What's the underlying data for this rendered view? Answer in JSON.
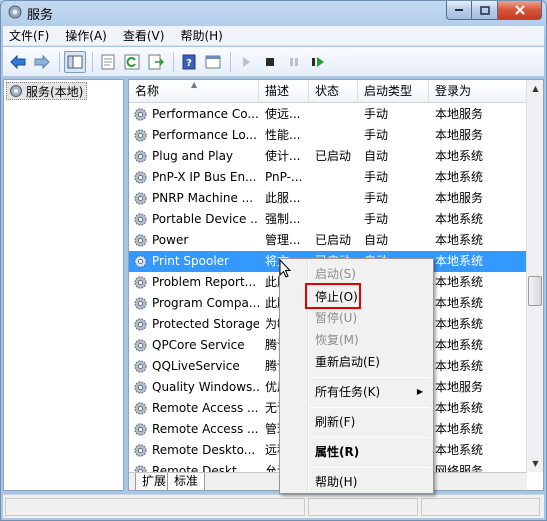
{
  "window": {
    "title": "服务"
  },
  "menubar": [
    "文件(F)",
    "操作(A)",
    "查看(V)",
    "帮助(H)"
  ],
  "toolbar": {
    "icons": [
      "back-arrow-icon",
      "forward-arrow-icon",
      "show-tree-icon",
      "properties-icon",
      "refresh-icon",
      "export-icon",
      "help-icon",
      "console-icon",
      "start-icon",
      "stop-icon",
      "pause-icon",
      "restart-icon"
    ]
  },
  "tree": {
    "root_label": "服务(本地)"
  },
  "columns": [
    "名称",
    "描述",
    "状态",
    "启动类型",
    "登录为"
  ],
  "rows": [
    {
      "name": "Performance Co...",
      "desc": "使远...",
      "state": "",
      "type": "手动",
      "logon": "本地服务"
    },
    {
      "name": "Performance Lo...",
      "desc": "性能...",
      "state": "",
      "type": "手动",
      "logon": "本地服务"
    },
    {
      "name": "Plug and Play",
      "desc": "使计...",
      "state": "已启动",
      "type": "自动",
      "logon": "本地系统"
    },
    {
      "name": "PnP-X IP Bus En...",
      "desc": "PnP-...",
      "state": "",
      "type": "手动",
      "logon": "本地系统"
    },
    {
      "name": "PNRP Machine ...",
      "desc": "此服...",
      "state": "",
      "type": "手动",
      "logon": "本地服务"
    },
    {
      "name": "Portable Device ...",
      "desc": "强制...",
      "state": "",
      "type": "手动",
      "logon": "本地系统"
    },
    {
      "name": "Power",
      "desc": "管理...",
      "state": "已启动",
      "type": "自动",
      "logon": "本地系统"
    },
    {
      "name": "Print Spooler",
      "desc": "将文",
      "state": "已启动",
      "type": "自动",
      "logon": "本地系统",
      "selected": true
    },
    {
      "name": "Problem Report...",
      "desc": "此服",
      "state": "",
      "type": "",
      "logon": "本地系统"
    },
    {
      "name": "Program Compa...",
      "desc": "此服",
      "state": "",
      "type": "",
      "logon": "本地系统"
    },
    {
      "name": "Protected Storage",
      "desc": "为敏",
      "state": "",
      "type": "",
      "logon": "本地系统"
    },
    {
      "name": "QPCore Service",
      "desc": "腾讯",
      "state": "",
      "type": "",
      "logon": "本地系统"
    },
    {
      "name": "QQLiveService",
      "desc": "腾讯",
      "state": "",
      "type": "",
      "logon": "本地系统"
    },
    {
      "name": "Quality Windows...",
      "desc": "优质",
      "state": "",
      "type": "",
      "logon": "本地服务"
    },
    {
      "name": "Remote Access ...",
      "desc": "无论",
      "state": "",
      "type": "",
      "logon": "本地系统"
    },
    {
      "name": "Remote Access ...",
      "desc": "管理",
      "state": "",
      "type": "",
      "logon": "本地系统"
    },
    {
      "name": "Remote Deskto...",
      "desc": "远程",
      "state": "",
      "type": "",
      "logon": "本地系统"
    },
    {
      "name": "Remote Deskt...",
      "desc": "允许",
      "state": "",
      "type": "",
      "logon": "网络服务"
    }
  ],
  "tabs": [
    "扩展",
    "标准"
  ],
  "context_menu": {
    "start": "启动(S)",
    "stop": "停止(O)",
    "pause": "暂停(U)",
    "resume": "恢复(M)",
    "restart": "重新启动(E)",
    "all_tasks": "所有任务(K)",
    "refresh": "刷新(F)",
    "properties": "属性(R)",
    "help": "帮助(H)"
  },
  "colors": {
    "selection": "#3399ff",
    "highlight_box": "#e00000"
  }
}
